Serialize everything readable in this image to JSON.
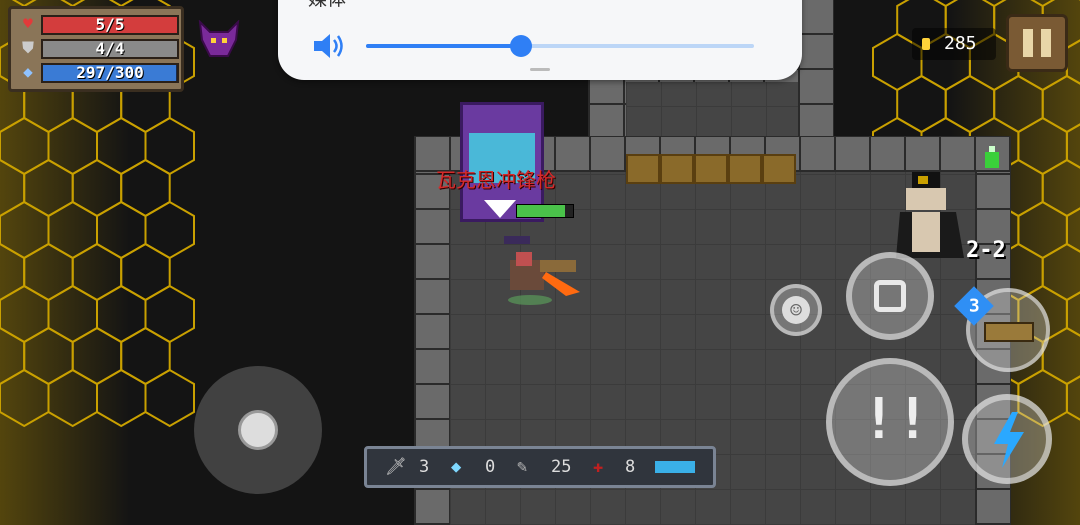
{
  "stats": {
    "hp": "5/5",
    "hp_fill": 1.0,
    "armor": "4/4",
    "armor_fill": 1.0,
    "energy": "297/300",
    "energy_fill": 0.99
  },
  "volume_overlay": {
    "title": "媒体",
    "level": 0.4
  },
  "coins": "285",
  "weapon_name": "瓦克恩冲锋枪",
  "stage": "2-2",
  "weapon_slot_badge": "3",
  "inventory": {
    "sword_count": "3",
    "gem_count": "0",
    "feather_count": "25",
    "cross_count": "8"
  },
  "colors": {
    "hp": "#d33d3d",
    "armor": "#8a8a8a",
    "energy": "#3a7bd5",
    "hex": "#c9a000",
    "accent": "#2f7ff5"
  }
}
